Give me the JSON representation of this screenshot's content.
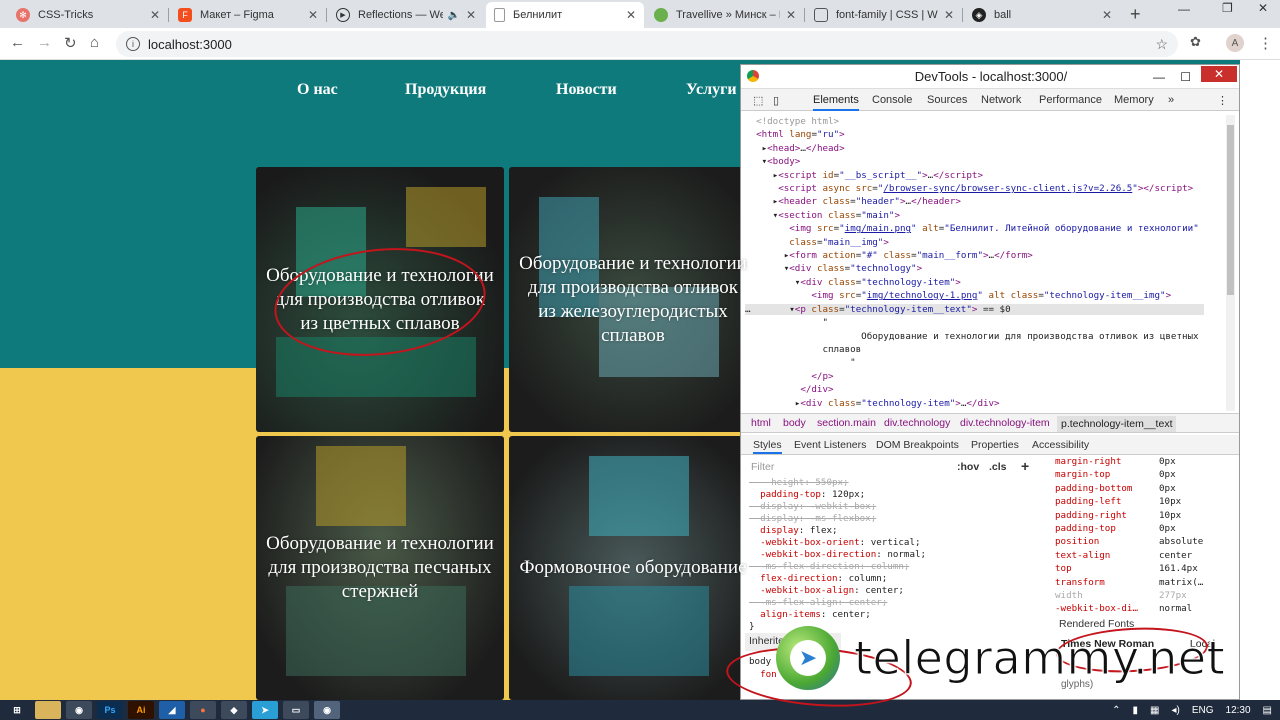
{
  "browser": {
    "tabs": [
      {
        "title": "CSS-Tricks",
        "icon": "css-tricks-icon",
        "color": "#e8736a"
      },
      {
        "title": "Макет – Figma",
        "icon": "figma-icon",
        "color": "#f24e1e"
      },
      {
        "title": "Reflections — We A",
        "icon": "play-icon",
        "color": "#333333"
      },
      {
        "title": "Белнилит",
        "icon": "document-icon",
        "color": "#888888"
      },
      {
        "title": "Travellive » Минск – Ри",
        "icon": "leaf-icon",
        "color": "#6ab04c"
      },
      {
        "title": "font-family | CSS | Web",
        "icon": "chat-icon",
        "color": "#555555"
      },
      {
        "title": "ball",
        "icon": "codepen-icon",
        "color": "#222222"
      }
    ],
    "url": "localhost:3000"
  },
  "site": {
    "nav": [
      "О нас",
      "Продукция",
      "Новости",
      "Услуги"
    ],
    "tiles": [
      "Оборудование и технологии для производства отливок из цветных сплавов",
      "Оборудование и технологии для производства отливок из железоуглеродистых сплавов",
      "Оборудование и технологии для производства песчаных стержней",
      "Формовочное оборудование"
    ]
  },
  "devtools": {
    "title": "DevTools - localhost:3000/",
    "tabs": [
      "Elements",
      "Console",
      "Sources",
      "Network",
      "Performance",
      "Memory",
      "»"
    ],
    "breadcrumbs": [
      "html",
      "body",
      "section.main",
      "div.technology",
      "div.technology-item",
      "p.technology-item__text"
    ],
    "style_tabs": [
      "Styles",
      "Event Listeners",
      "DOM Breakpoints",
      "Properties",
      "Accessibility"
    ],
    "filter_placeholder": "Filter",
    "hov": ":hov",
    "cls": ".cls",
    "computed": [
      {
        "name": "margin-right",
        "value": "0px"
      },
      {
        "name": "margin-top",
        "value": "0px"
      },
      {
        "name": "padding-bottom",
        "value": "0px"
      },
      {
        "name": "padding-left",
        "value": "10px"
      },
      {
        "name": "padding-right",
        "value": "10px"
      },
      {
        "name": "padding-top",
        "value": "0px"
      },
      {
        "name": "position",
        "value": "absolute"
      },
      {
        "name": "text-align",
        "value": "center"
      },
      {
        "name": "top",
        "value": "161.4px"
      },
      {
        "name": "transform",
        "value": "matrix(…"
      },
      {
        "name": "width",
        "value": "277px"
      },
      {
        "name": "-webkit-box-di…",
        "value": "normal"
      }
    ],
    "rendered_fonts_label": "Rendered Fonts",
    "rendered_font": "Times New Roman",
    "rendered_font_src": "Local",
    "rendered_glyphs": "glyphs)",
    "inherited_label": "Inherited"
  },
  "watermark": "telegrammy.net",
  "taskbar": {
    "lang": "ENG",
    "time": "12:30"
  }
}
